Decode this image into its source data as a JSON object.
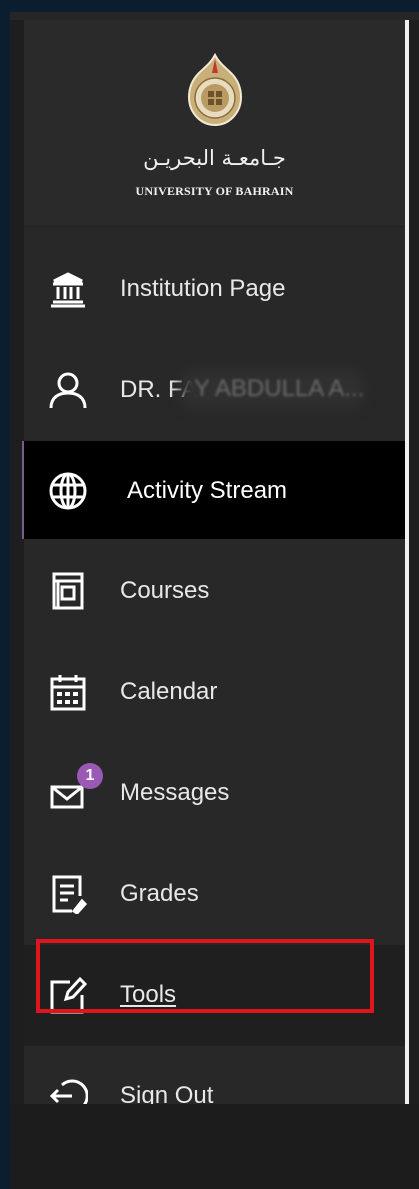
{
  "header": {
    "arabic_name": "جـامعـة البحريـن",
    "university_name": "UNIVERSITY OF BAHRAIN"
  },
  "nav": {
    "institution": "Institution Page",
    "profile": "DR. FA",
    "activity": "Activity Stream",
    "courses": "Courses",
    "calendar": "Calendar",
    "messages": "Messages",
    "messages_badge": "1",
    "grades": "Grades",
    "tools": "Tools",
    "signout": "Sign Out"
  },
  "colors": {
    "background": "#282828",
    "active": "#000000",
    "badge": "#9b59b6",
    "highlight": "#e0141c"
  },
  "icons": [
    "institution-icon",
    "user-icon",
    "globe-icon",
    "courses-icon",
    "calendar-icon",
    "messages-icon",
    "grades-icon",
    "tools-icon",
    "sign-out-icon"
  ]
}
